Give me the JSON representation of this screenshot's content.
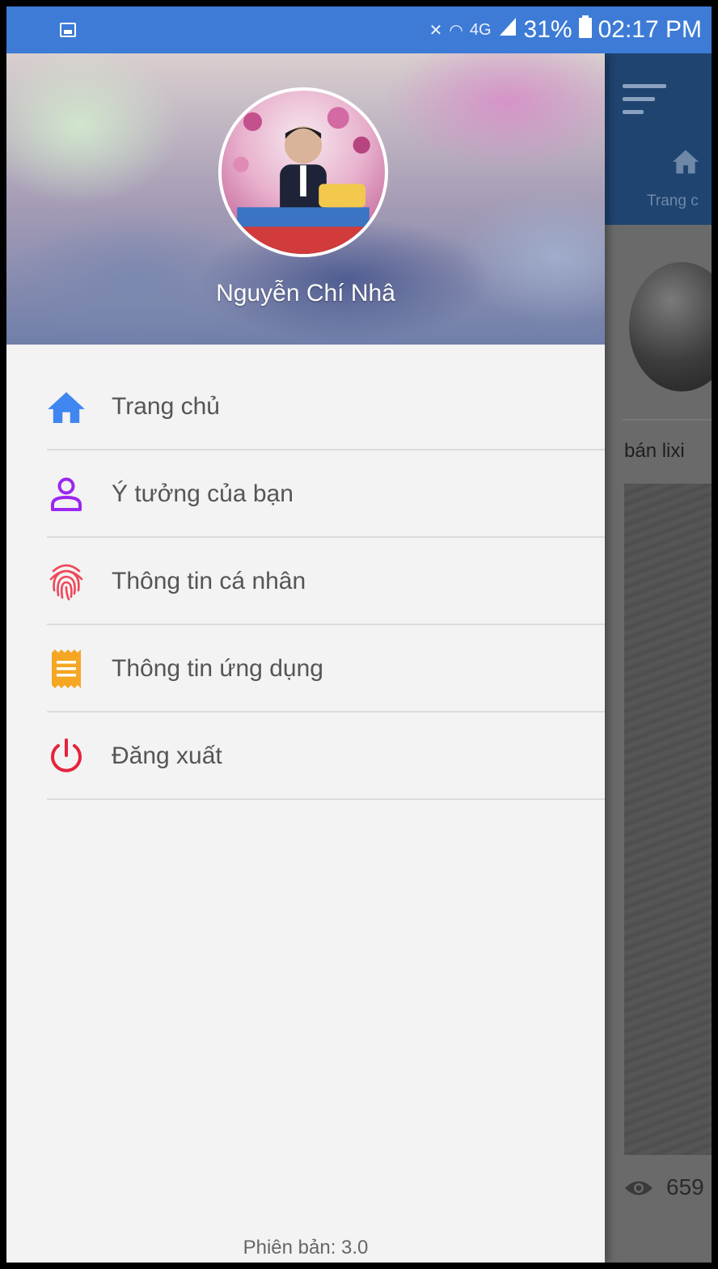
{
  "status_bar": {
    "network_label": "4G",
    "battery": "31%",
    "time": "02:17 PM"
  },
  "drawer": {
    "user_name": "Nguyễn Chí Nhâ",
    "menu": [
      {
        "label": "Trang chủ",
        "icon": "home-icon",
        "color": "#3f86f0"
      },
      {
        "label": "Ý tưởng của bạn",
        "icon": "person-icon",
        "color": "#9c27f0"
      },
      {
        "label": "Thông tin cá nhân",
        "icon": "fingerprint-icon",
        "color": "#f0475a"
      },
      {
        "label": "Thông tin ứng dụng",
        "icon": "receipt-icon",
        "color": "#f5a623"
      },
      {
        "label": "Đăng xuất",
        "icon": "power-icon",
        "color": "#e5233c"
      }
    ],
    "version": "Phiên bản: 3.0"
  },
  "background_app": {
    "tab_label": "Trang c",
    "post_text": "bán lixi",
    "view_count": "659"
  }
}
